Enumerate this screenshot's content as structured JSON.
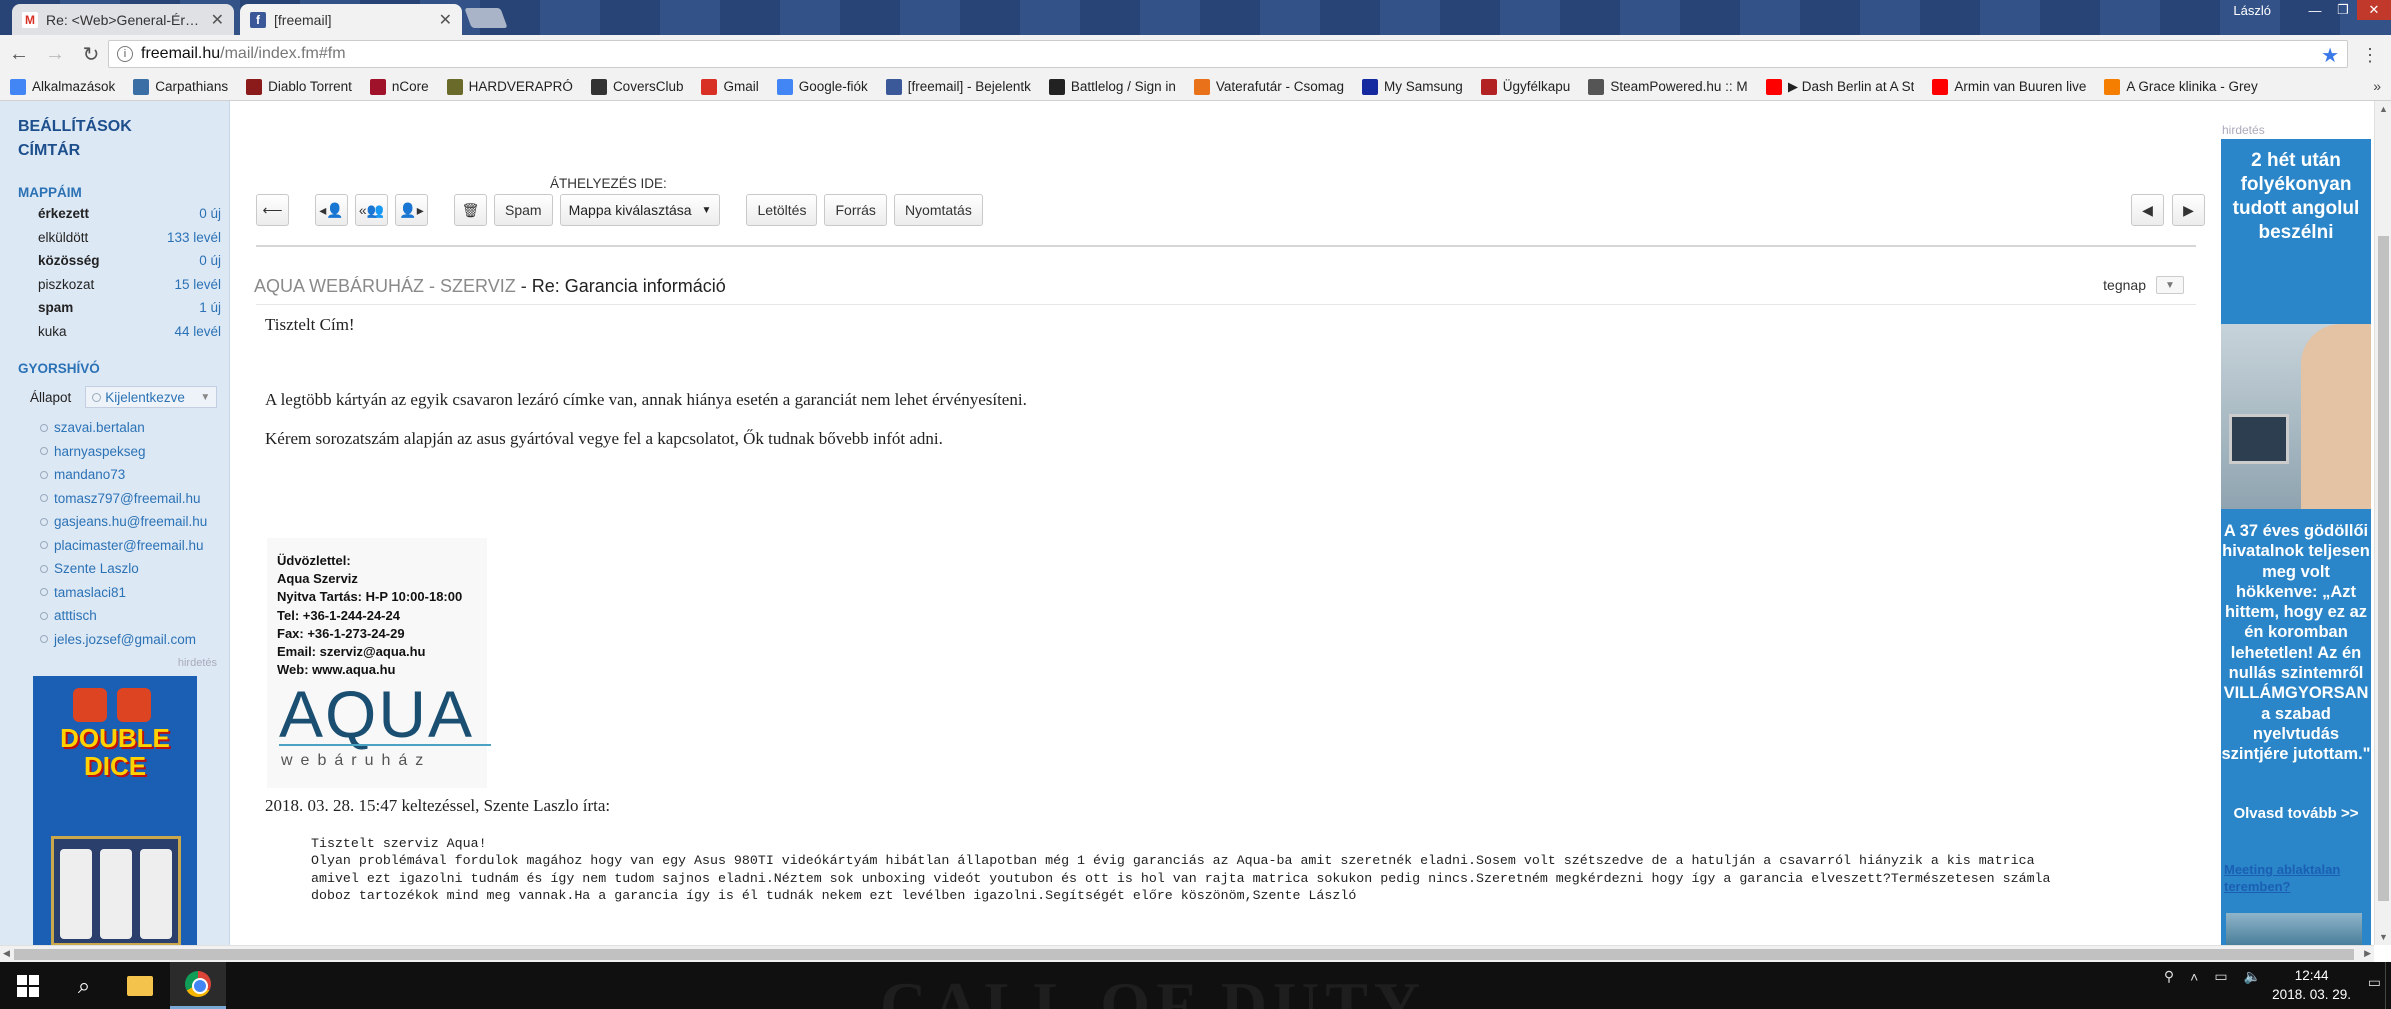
{
  "browser": {
    "tabs": [
      {
        "title": "Re: <Web>General-Érték",
        "favicon_color": "#ffffff",
        "favicon_letter": "M",
        "active": false
      },
      {
        "title": "[freemail]",
        "favicon_color": "#3b5998",
        "favicon_letter": "f",
        "active": true
      }
    ],
    "user": "László",
    "url_host": "freemail.hu",
    "url_path": "/mail/index.fm#fm"
  },
  "bookmarks": [
    {
      "label": "Alkalmazások",
      "icon": "apps-grid-icon",
      "color": "#4285f4"
    },
    {
      "label": "Carpathians",
      "icon": "earth-icon",
      "color": "#3a6ea5"
    },
    {
      "label": "Diablo Torrent",
      "icon": "diablo-icon",
      "color": "#8b1a1a"
    },
    {
      "label": "nCore",
      "icon": "ncore-icon",
      "color": "#a0122a"
    },
    {
      "label": "HARDVERAPRÓ",
      "icon": "hardverapro-icon",
      "color": "#6a6a2a"
    },
    {
      "label": "CoversClub",
      "icon": "coversclub-icon",
      "color": "#333333"
    },
    {
      "label": "Gmail",
      "icon": "gmail-icon",
      "color": "#d93025"
    },
    {
      "label": "Google-fiók",
      "icon": "google-icon",
      "color": "#4285f4"
    },
    {
      "label": "[freemail] - Bejelentk",
      "icon": "freemail-icon",
      "color": "#3b5998"
    },
    {
      "label": "Battlelog / Sign in",
      "icon": "battlelog-icon",
      "color": "#222222"
    },
    {
      "label": "Vaterafutár - Csomag",
      "icon": "vatera-icon",
      "color": "#e8711a"
    },
    {
      "label": "My Samsung",
      "icon": "samsung-icon",
      "color": "#1428a0"
    },
    {
      "label": "Ügyfélkapu",
      "icon": "ugyfelkapu-icon",
      "color": "#b22222"
    },
    {
      "label": "SteamPowered.hu :: M",
      "icon": "steam-icon",
      "color": "#555555"
    },
    {
      "label": "▶ Dash Berlin at A St",
      "icon": "youtube-icon",
      "color": "#ff0000"
    },
    {
      "label": "Armin van Buuren live",
      "icon": "youtube-icon",
      "color": "#ff0000"
    },
    {
      "label": "A Grace klinika - Grey",
      "icon": "blogger-icon",
      "color": "#f57d00"
    }
  ],
  "sidebar": {
    "links": [
      "BEÁLLÍTÁSOK",
      "CÍMTÁR"
    ],
    "folders_heading": "MAPPÁIM",
    "folders": [
      {
        "name": "érkezett",
        "count": "0 új",
        "bold": true
      },
      {
        "name": "elküldött",
        "count": "133 levél",
        "bold": false
      },
      {
        "name": "közösség",
        "count": "0 új",
        "bold": true
      },
      {
        "name": "piszkozat",
        "count": "15 levél",
        "bold": false
      },
      {
        "name": "spam",
        "count": "1 új",
        "bold": true
      },
      {
        "name": "kuka",
        "count": "44 levél",
        "bold": false
      }
    ],
    "quick_heading": "GYORSHÍVÓ",
    "status_label": "Állapot",
    "status_value": "Kijelentkezve",
    "contacts": [
      "szavai.bertalan",
      "harnyaspekseg",
      "mandano73",
      "tomasz797@freemail.hu",
      "gasjeans.hu@freemail.hu",
      "placimaster@freemail.hu",
      "Szente Laszlo",
      "tamaslaci81",
      "atttisch",
      "jeles.jozsef@gmail.com"
    ],
    "ad_label": "hirdetés",
    "ad_title": "DOUBLE DICE"
  },
  "toolbar": {
    "move_label": "ÁTHELYEZÉS IDE:",
    "spam": "Spam",
    "folder_select": "Mappa kiválasztása",
    "download": "Letöltés",
    "source": "Forrás",
    "print": "Nyomtatás"
  },
  "message": {
    "from": "AQUA WEBÁRUHÁZ - SZERVIZ",
    "separator": " - ",
    "subject": "Re: Garancia információ",
    "date": "tegnap",
    "greeting": "Tisztelt Cím!",
    "para1": "A legtöbb kártyán az egyik csavaron lezáró címke van, annak hiánya esetén a garanciát nem lehet érvényesíteni.",
    "para2": "Kérem sorozatszám alapján az asus gyártóval vegye fel a kapcsolatot, Ők tudnak bővebb infót adni.",
    "signature": [
      "Üdvözlettel:",
      "Aqua Szerviz",
      "Nyitva Tartás: H-P 10:00-18:00",
      "Tel: +36-1-244-24-24",
      "Fax: +36-1-273-24-29",
      "Email: szerviz@aqua.hu",
      "Web: www.aqua.hu"
    ],
    "logo_text": "AQUA",
    "logo_sub": "webáruház",
    "quote_header": "2018. 03. 28. 15:47 keltezéssel, Szente Laszlo írta:",
    "quoted": "Tisztelt szerviz Aqua!\nOlyan problémával fordulok magához hogy van egy Asus 980TI videókártyám hibátlan állapotban még 1 évig garanciás az Aqua-ba amit szeretnék eladni.Sosem volt szétszedve de a hatulján a csavarról hiányzik a kis matrica\namivel ezt igazolni tudnám és így nem tudom sajnos eladni.Néztem sok unboxing videót youtubon és ott is hol van rajta matrica sokukon pedig nincs.Szeretném megkérdezni hogy így a garancia elveszett?Természetesen számla\ndoboz tartozékok mind meg vannak.Ha a garancia így is él tudnák nekem ezt levélben igazolni.Segítségét előre köszönöm,Szente László"
  },
  "ad_right": {
    "label": "hirdetés",
    "headline": "2 hét után folyékonyan tudott angolul beszélni",
    "body": "A 37 éves gödöllői hivatalnok teljesen meg volt hökkenve: „Azt hittem, hogy ez az én koromban lehetetlen! Az én nullás szintemről VILLÁMGYORSAN a szabad nyelvtudás szintjére jutottam.\"",
    "cta": "Olvasd tovább >>",
    "ad2": "Meeting ablaktalan teremben?"
  },
  "taskbar": {
    "time": "12:44",
    "date": "2018. 03. 29.",
    "wallpaper_text": "CALL OF DUTY"
  }
}
